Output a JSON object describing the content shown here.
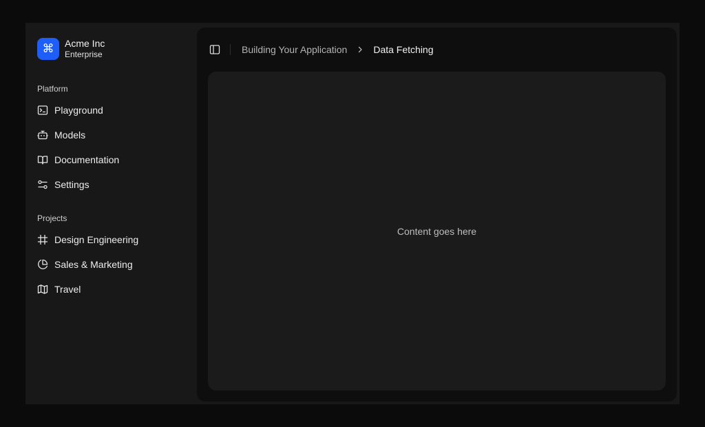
{
  "team": {
    "logo_glyph": "⌘",
    "name": "Acme Inc",
    "plan": "Enterprise",
    "logo_color": "#1f5ef6"
  },
  "sidebar": {
    "platform_label": "Platform",
    "platform_items": [
      {
        "label": "Playground",
        "icon": "terminal-icon"
      },
      {
        "label": "Models",
        "icon": "bot-icon"
      },
      {
        "label": "Documentation",
        "icon": "book-open-icon"
      },
      {
        "label": "Settings",
        "icon": "sliders-icon"
      }
    ],
    "projects_label": "Projects",
    "project_items": [
      {
        "label": "Design Engineering",
        "icon": "frame-icon"
      },
      {
        "label": "Sales & Marketing",
        "icon": "pie-chart-icon"
      },
      {
        "label": "Travel",
        "icon": "map-icon"
      }
    ]
  },
  "header": {
    "toggle_icon": "panel-left-icon",
    "breadcrumb": {
      "parent": "Building Your Application",
      "separator_icon": "chevron-right-icon",
      "current": "Data Fetching"
    }
  },
  "main": {
    "placeholder": "Content goes here"
  }
}
